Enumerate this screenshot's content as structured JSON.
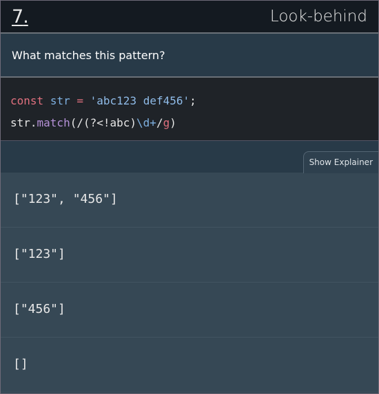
{
  "header": {
    "number": "7",
    "dot": ".",
    "title": "Look-behind"
  },
  "question": "What matches this pattern?",
  "code": {
    "line1": {
      "kw": "const",
      "var": "str",
      "eq": "=",
      "str": "'abc123 def456'",
      "semi": ";"
    },
    "line2": {
      "obj": "str.",
      "fn": "match",
      "open": "(/(?<!abc)",
      "re": "\\d+",
      "slash": "/",
      "flag": "g",
      "close": ")"
    }
  },
  "explainer_button": "Show Explainer",
  "answers": [
    "[\"123\", \"456\"]",
    "[\"123\"]",
    "[\"456\"]",
    "[]"
  ]
}
